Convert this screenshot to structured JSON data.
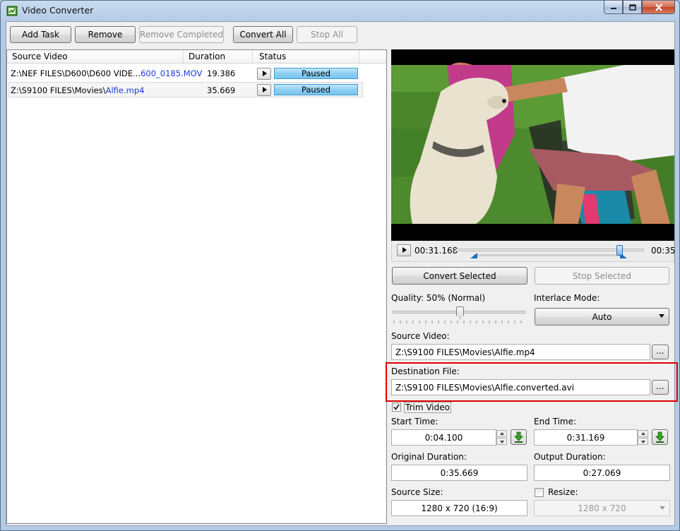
{
  "window": {
    "title": "Video Converter"
  },
  "toolbar": {
    "add_task": "Add Task",
    "remove": "Remove",
    "remove_completed": "Remove Completed",
    "convert_all": "Convert All",
    "stop_all": "Stop All"
  },
  "list": {
    "headers": {
      "source": "Source Video",
      "duration": "Duration",
      "status": "Status"
    },
    "rows": [
      {
        "path_prefix": "Z:\\NEF FILES\\D600\\D600 VIDE...",
        "file": "600_0185.MOV",
        "duration": "19.386",
        "status": "Paused"
      },
      {
        "path_prefix": "Z:\\S9100 FILES\\Movies\\",
        "file": "Alfie.mp4",
        "duration": "35.669",
        "status": "Paused"
      }
    ]
  },
  "player": {
    "current_time": "00:31.168",
    "end_time": "00:35"
  },
  "actions": {
    "convert_selected": "Convert Selected",
    "stop_selected": "Stop Selected"
  },
  "quality": {
    "label": "Quality: 50% (Normal)",
    "level": 0.5
  },
  "interlace": {
    "label": "Interlace Mode:",
    "value": "Auto"
  },
  "source_video": {
    "label": "Source Video:",
    "value": "Z:\\S9100 FILES\\Movies\\Alfie.mp4",
    "browse": "..."
  },
  "destination": {
    "label": "Destination File:",
    "value": "Z:\\S9100 FILES\\Movies\\Alfie.converted.avi",
    "browse": "..."
  },
  "trim": {
    "label": "Trim Video",
    "checked": true
  },
  "start_time": {
    "label": "Start Time:",
    "value": "0:04.100"
  },
  "end_time": {
    "label": "End Time:",
    "value": "0:31.169"
  },
  "original_duration": {
    "label": "Original Duration:",
    "value": "0:35.669"
  },
  "output_duration": {
    "label": "Output Duration:",
    "value": "0:27.069"
  },
  "source_size": {
    "label": "Source Size:",
    "value": "1280 x 720 (16:9)"
  },
  "resize": {
    "label": "Resize:",
    "checked": false,
    "value": "1280 x 720"
  }
}
